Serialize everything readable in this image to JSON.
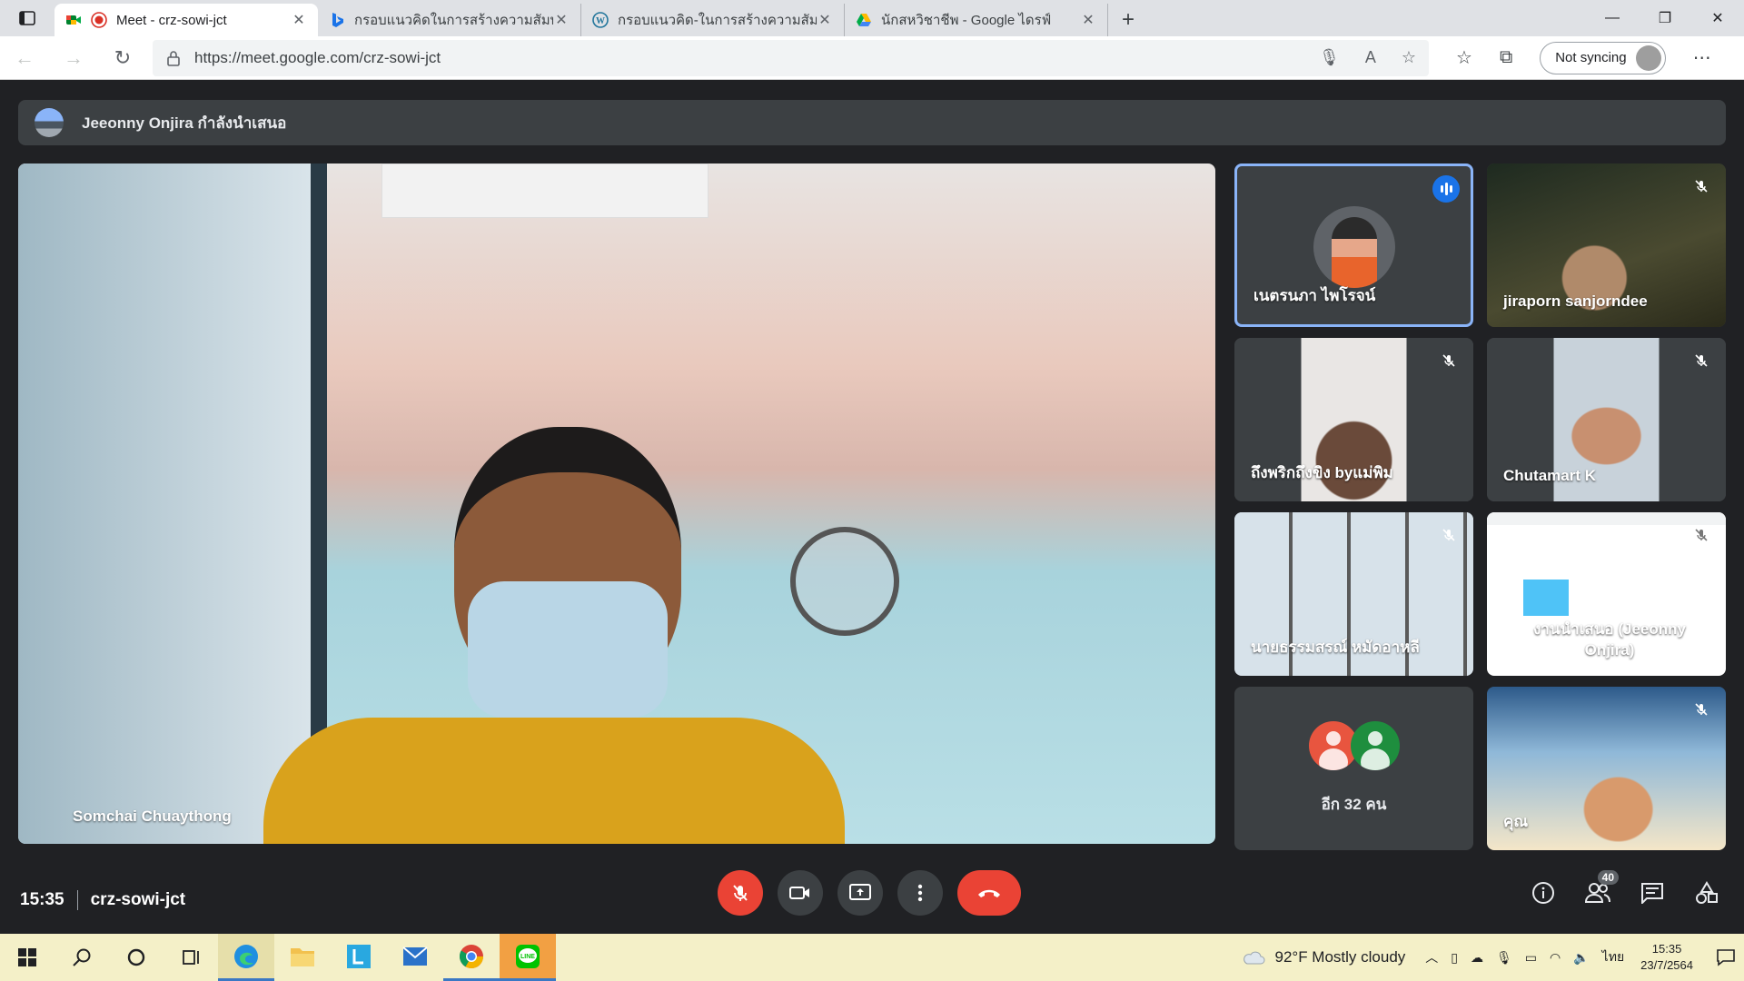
{
  "browser": {
    "tabs": [
      {
        "title": "Meet - crz-sowi-jct",
        "active": true,
        "icon": "google-meet-icon"
      },
      {
        "title": "กรอบแนวคิดในการสร้างความสัมพันธ์ก",
        "active": false,
        "icon": "bing-icon"
      },
      {
        "title": "กรอบแนวคิด-ในการสร้างความสัมพันธ์",
        "active": false,
        "icon": "wordpress-icon"
      },
      {
        "title": "นักสหวิชาชีพ - Google ไดรฟ์",
        "active": false,
        "icon": "google-drive-icon"
      }
    ],
    "url": "https://meet.google.com/crz-sowi-jct",
    "sync_label": "Not syncing"
  },
  "meet": {
    "presenting_banner": "Jeeonny Onjira กำลังนำเสนอ",
    "main_participant": "Somchai Chuaythong",
    "participants": [
      {
        "name": "เนตรนภา ไพโรจน์",
        "speaking": true
      },
      {
        "name": "jiraporn sanjorndee",
        "muted": true
      },
      {
        "name": "ถึงพริกถึงขิง byแม่พิม",
        "muted": true
      },
      {
        "name": "Chutamart K",
        "muted": true
      },
      {
        "name": "นายธรรมสรณ์ หมัดอาหลี",
        "muted": true
      },
      {
        "name": "งานนำเสนอ (Jeeonny Onjira)",
        "muted": true
      },
      {
        "name": "คุณ",
        "muted": true
      }
    ],
    "others_label": "อีก 32 คน",
    "time": "15:35",
    "meeting_code": "crz-sowi-jct",
    "participants_count": "40"
  },
  "taskbar": {
    "weather": "92°F  Mostly cloudy",
    "language": "ไทย",
    "clock_time": "15:35",
    "clock_date": "23/7/2564"
  },
  "colors": {
    "meet_bg": "#202124",
    "tile_bg": "#3c4043",
    "danger": "#ea4335",
    "speaking_ring": "#8ab4f8",
    "taskbar_bg": "#f4f0c8"
  }
}
